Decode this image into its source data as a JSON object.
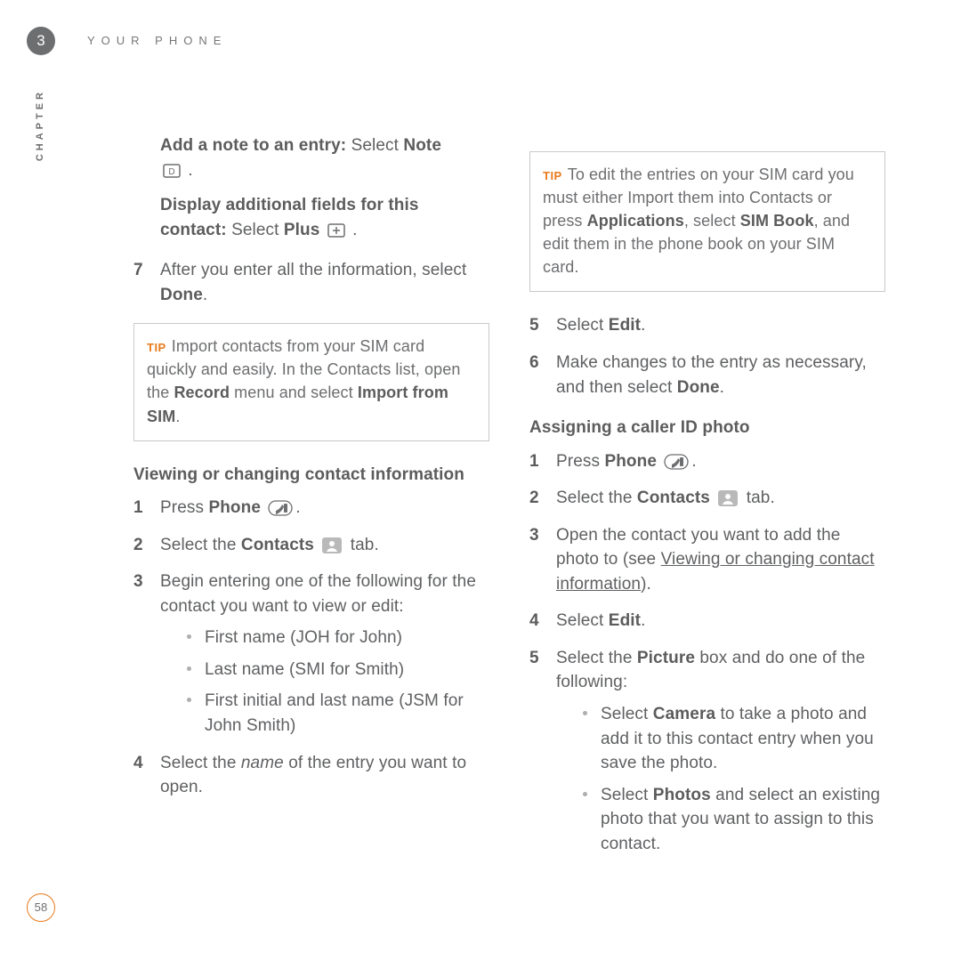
{
  "chapter": {
    "number": "3",
    "header": "YOUR PHONE",
    "side": "CHAPTER"
  },
  "left": {
    "addNote": {
      "lead": "Add a note to an entry:",
      "rest": " Select ",
      "bold": "Note"
    },
    "displayFields": {
      "lead": "Display additional fields for this contact:",
      "rest": " Select ",
      "bold": "Plus",
      "tail": " ."
    },
    "step7": {
      "num": "7",
      "t1": "After you enter all the information, select ",
      "b1": "Done",
      "t2": "."
    },
    "tip": {
      "t1": "Import contacts from your SIM card quickly and easily. In the Contacts list, open the ",
      "b1": "Record",
      "t2": " menu and select ",
      "b2": "Import from SIM",
      "t3": "."
    },
    "secTitle": "Viewing or changing contact information",
    "s1": {
      "num": "1",
      "t1": "Press ",
      "b1": "Phone ",
      "t2": "."
    },
    "s2": {
      "num": "2",
      "t1": "Select the ",
      "b1": "Contacts ",
      "t2": " tab."
    },
    "s3": {
      "num": "3",
      "t1": "Begin entering one of the following for the contact you want to view or edit:",
      "bul1": "First name (JOH for John)",
      "bul2": "Last name (SMI for Smith)",
      "bul3": "First initial and last name (JSM for John Smith)"
    },
    "s4": {
      "num": "4",
      "t1": "Select the ",
      "i1": "name",
      "t2": " of the entry you want to open."
    }
  },
  "right": {
    "tip": {
      "t1": "To edit the entries on your SIM card you must either Import them into Contacts or press ",
      "b1": "Applications",
      "t2": ", select ",
      "b2": "SIM Book",
      "t3": ", and edit them in the phone book on your SIM card."
    },
    "s5": {
      "num": "5",
      "t1": "Select ",
      "b1": "Edit",
      "t2": "."
    },
    "s6": {
      "num": "6",
      "t1": "Make changes to the entry as necessary, and then select ",
      "b1": "Done",
      "t2": "."
    },
    "secTitle": "Assigning a caller ID photo",
    "a1": {
      "num": "1",
      "t1": "Press ",
      "b1": "Phone ",
      "t2": "."
    },
    "a2": {
      "num": "2",
      "t1": "Select the ",
      "b1": "Contacts ",
      "t2": " tab."
    },
    "a3": {
      "num": "3",
      "t1": "Open the contact you want to add the photo to (see ",
      "link": "Viewing or changing contact information",
      "t2": ")."
    },
    "a4": {
      "num": "4",
      "t1": "Select ",
      "b1": "Edit",
      "t2": "."
    },
    "a5": {
      "num": "5",
      "t1": "Select the ",
      "b1": "Picture",
      "t2": " box and do one of the following:",
      "bul1a": "Select ",
      "bul1b": "Camera",
      "bul1c": " to take a photo and add it to this contact entry when you save the photo.",
      "bul2a": "Select ",
      "bul2b": "Photos",
      "bul2c": " and select an existing photo that you want to assign to this contact."
    }
  },
  "pageNumber": "58"
}
